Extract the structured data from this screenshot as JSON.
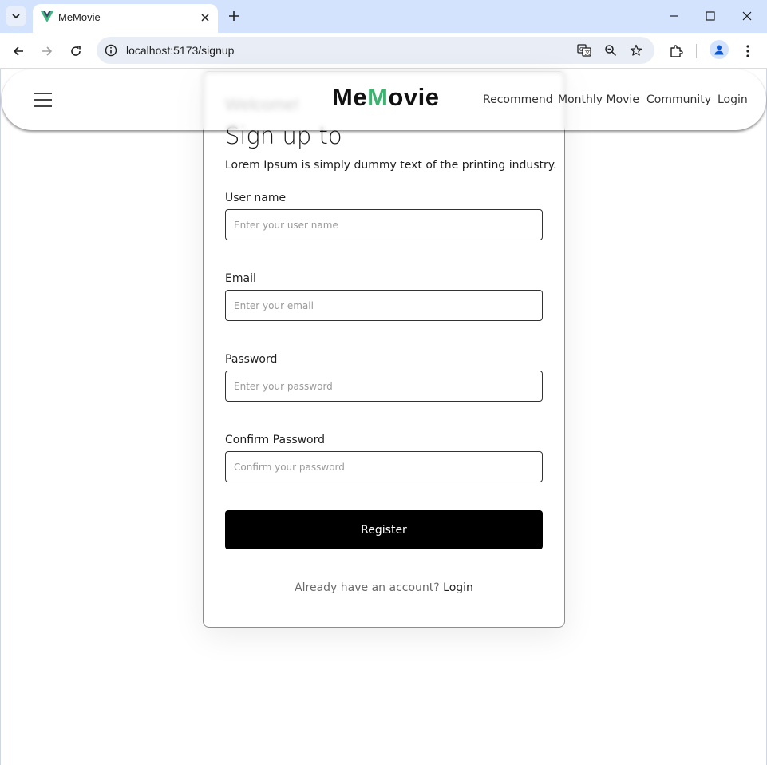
{
  "browser": {
    "tab_title": "MeMovie",
    "url": "localhost:5173/signup",
    "icons": [
      "tab-search-icon",
      "vue-favicon-icon",
      "close-icon",
      "plus-icon",
      "minimize-icon",
      "maximize-icon",
      "close-window-icon",
      "back-arrow-icon",
      "forward-arrow-icon",
      "reload-icon",
      "site-info-icon",
      "translate-icon",
      "zoom-icon",
      "star-icon",
      "extensions-icon",
      "profile-icon",
      "menu-dots-icon"
    ]
  },
  "navbar": {
    "brand_part1": "Me",
    "brand_part2": "M",
    "brand_part3": "ovie",
    "brand_accent_color": "#3cb371",
    "links": [
      "Recommend",
      "Monthly Movie",
      "Community",
      "Login"
    ]
  },
  "signup": {
    "welcome": "Welcome!",
    "title": "Sign up to",
    "subtitle": "Lorem Ipsum is simply dummy text of the printing industry.",
    "fields": [
      {
        "label": "User name",
        "placeholder": "Enter your user name",
        "value": ""
      },
      {
        "label": "Email",
        "placeholder": "Enter your email",
        "value": ""
      },
      {
        "label": "Password",
        "placeholder": "Enter your password",
        "value": ""
      },
      {
        "label": "Confirm Password",
        "placeholder": "Confirm your password",
        "value": ""
      }
    ],
    "register_label": "Register",
    "already_text": "Already have an account?",
    "login_link": "Login"
  }
}
